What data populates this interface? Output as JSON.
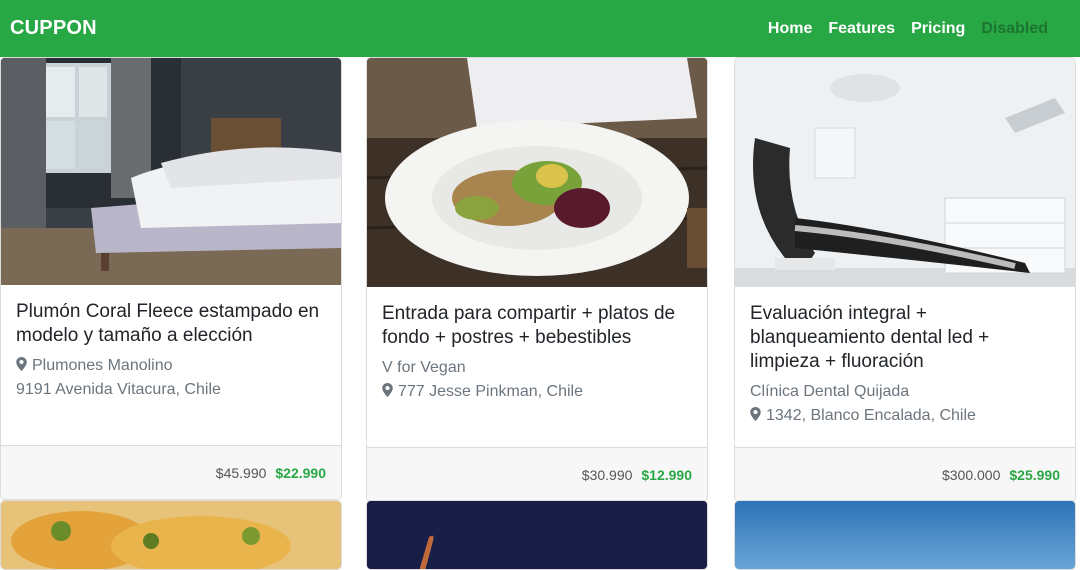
{
  "navbar": {
    "brand": "CUPPON",
    "links": [
      {
        "label": "Home"
      },
      {
        "label": "Features"
      },
      {
        "label": "Pricing"
      },
      {
        "label": "Disabled"
      }
    ]
  },
  "cards": [
    {
      "title": "Plumón Coral Fleece estampado en modelo y tamaño a elección",
      "merchant": "Plumones Manolino",
      "address": "9191 Avenida Vitacura, Chile",
      "old_price": "$45.990",
      "new_price": "$22.990",
      "image": "bedroom-image"
    },
    {
      "title": "Entrada para compartir + platos de fondo + postres + bebestibles",
      "merchant": "V for Vegan",
      "address": "777 Jesse Pinkman, Chile",
      "old_price": "$30.990",
      "new_price": "$12.990",
      "image": "food-plate-image"
    },
    {
      "title": "Evaluación integral + blanqueamiento dental led + limpieza + fluoración",
      "merchant": "Clínica Dental Quijada",
      "address": "1342, Blanco Encalada, Chile",
      "old_price": "$300.000",
      "new_price": "$25.990",
      "image": "dental-chair-image"
    }
  ],
  "colors": {
    "brand_green": "#28a745",
    "price_green": "#28a745"
  },
  "icons": [
    "map-marker-icon"
  ]
}
